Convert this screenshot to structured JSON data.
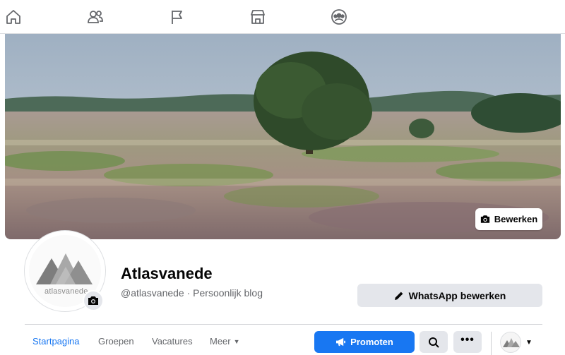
{
  "topnav": {
    "icons": [
      "home-icon",
      "friends-icon",
      "pages-flag-icon",
      "marketplace-icon",
      "groups-icon"
    ]
  },
  "cover": {
    "edit_label": "Bewerken"
  },
  "profile": {
    "avatar_text": "atlasvanede",
    "name": "Atlasvanede",
    "handle": "@atlasvanede · Persoonlijk blog"
  },
  "actions": {
    "whatsapp_label": "WhatsApp bewerken",
    "promote_label": "Promoten",
    "more_label": "•••"
  },
  "tabs": [
    {
      "label": "Startpagina",
      "active": true
    },
    {
      "label": "Groepen",
      "active": false
    },
    {
      "label": "Vacatures",
      "active": false
    },
    {
      "label": "Meer",
      "active": false
    }
  ],
  "colors": {
    "accent": "#1877f2",
    "button_gray": "#e4e6eb",
    "secondary_text": "#65676b"
  }
}
